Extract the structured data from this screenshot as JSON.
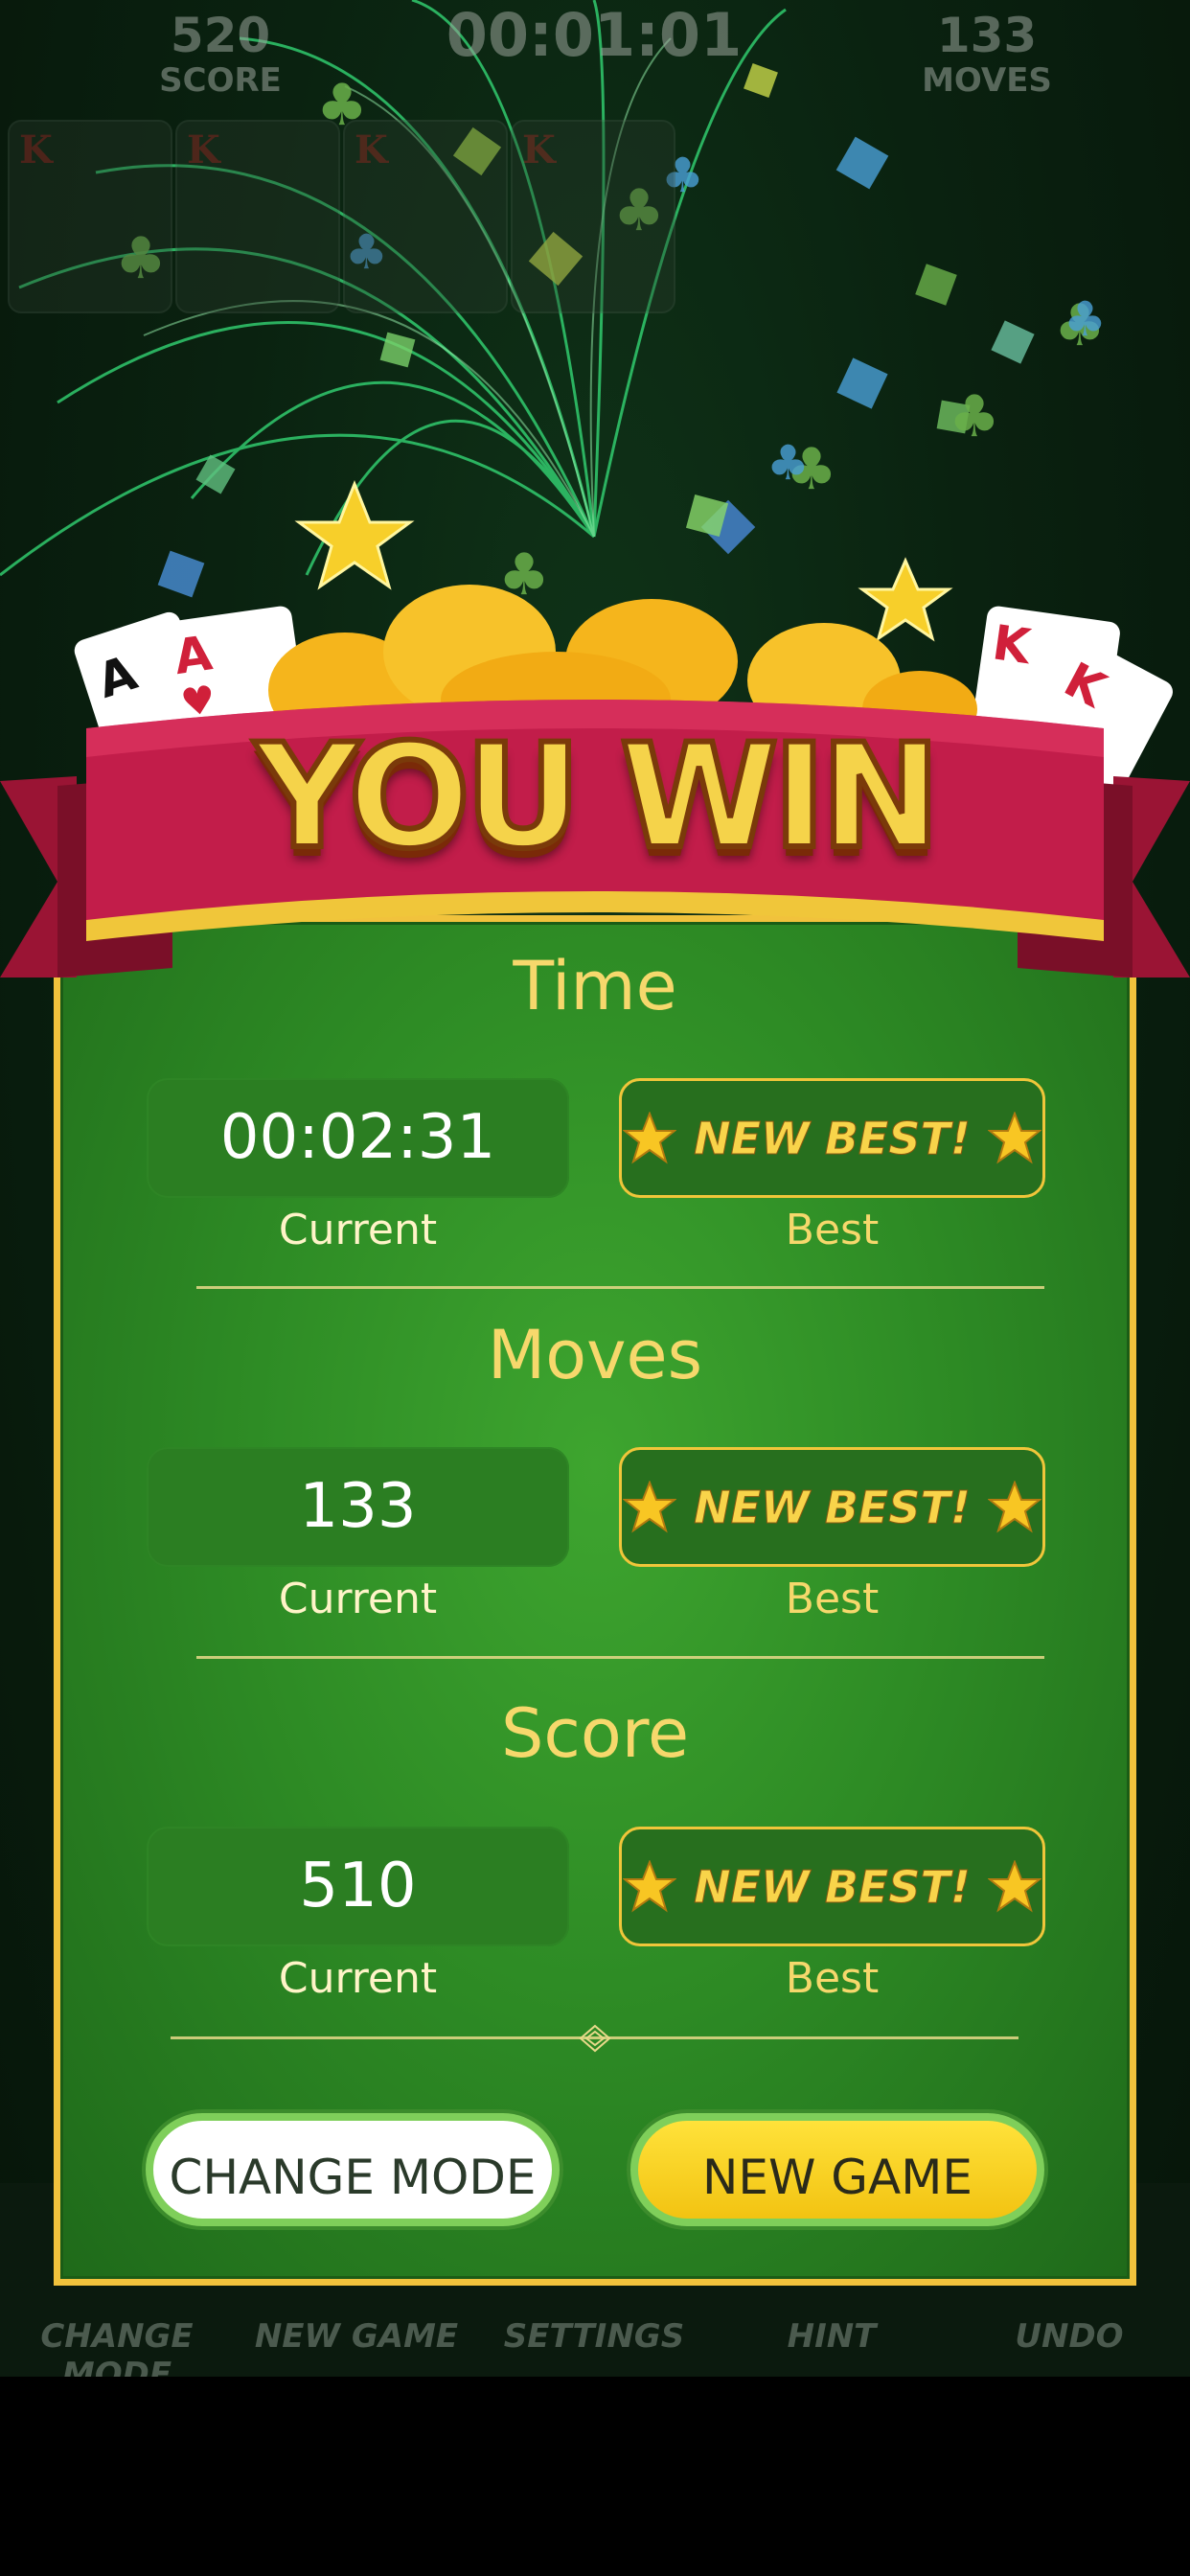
{
  "top_bar": {
    "score_value": "520",
    "score_label": "SCORE",
    "time_value": "00:01:01",
    "moves_value": "133",
    "moves_label": "MOVES"
  },
  "foundations": [
    "K",
    "K",
    "K",
    "K"
  ],
  "banner": {
    "title": "YOU WIN"
  },
  "dialog": {
    "sections": [
      {
        "title": "Time",
        "current_value": "00:02:31",
        "current_label": "Current",
        "best_badge": "NEW BEST!",
        "best_label": "Best"
      },
      {
        "title": "Moves",
        "current_value": "133",
        "current_label": "Current",
        "best_badge": "NEW BEST!",
        "best_label": "Best"
      },
      {
        "title": "Score",
        "current_value": "510",
        "current_label": "Current",
        "best_badge": "NEW BEST!",
        "best_label": "Best"
      }
    ],
    "change_mode_label": "CHANGE MODE",
    "new_game_label": "NEW GAME"
  },
  "toolbar": {
    "items": [
      "CHANGE MODE",
      "NEW GAME",
      "SETTINGS",
      "HINT",
      "UNDO"
    ]
  },
  "colors": {
    "felt_green": "#2e8c25",
    "gold_border": "#f1c23c",
    "ribbon_red": "#b81c44",
    "title_gold": "#f6d86c"
  }
}
